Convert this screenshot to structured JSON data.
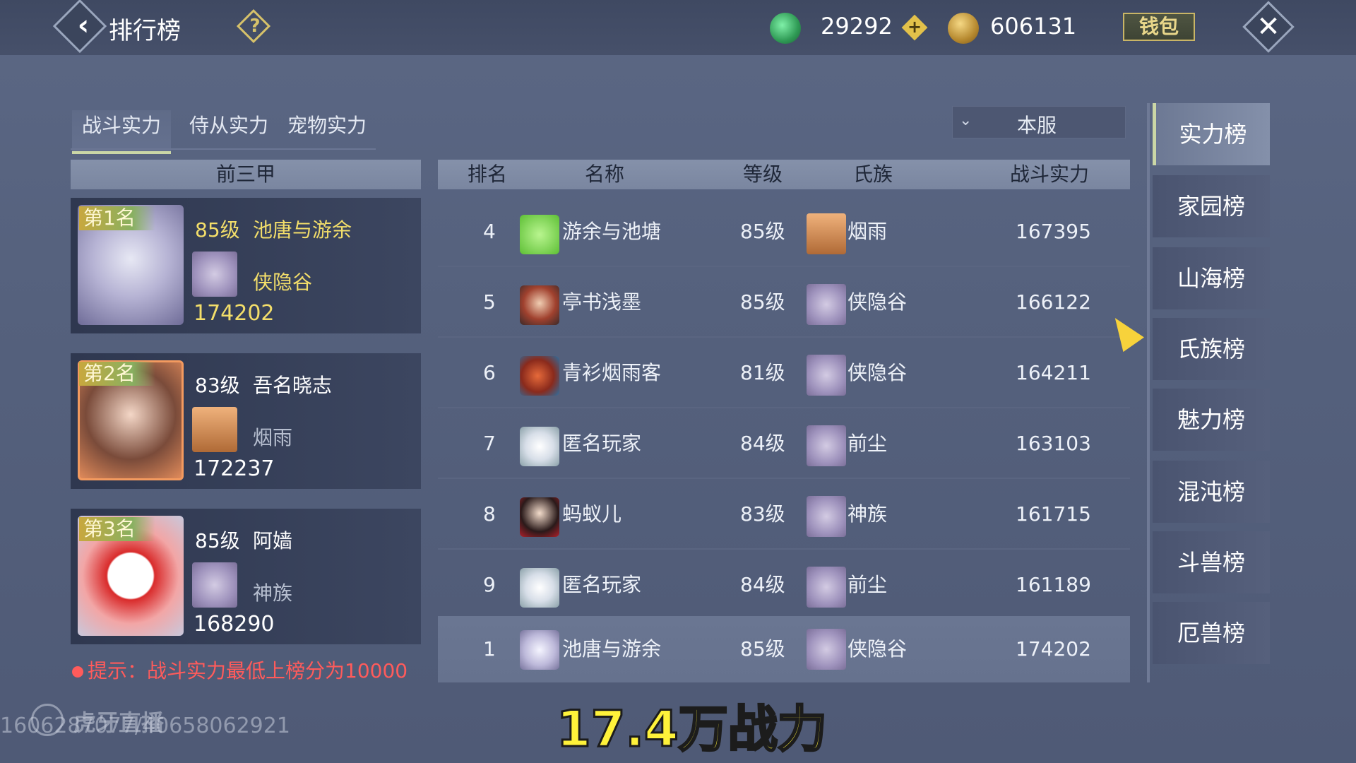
{
  "header": {
    "title": "排行榜",
    "jade_value": "29292",
    "coin_value": "606131",
    "wallet_label": "钱包"
  },
  "tabs": [
    {
      "label": "战斗实力",
      "active": true
    },
    {
      "label": "侍从实力",
      "active": false
    },
    {
      "label": "宠物实力",
      "active": false
    }
  ],
  "server_filter": "本服",
  "top3": {
    "header": "前三甲",
    "cards": [
      {
        "rank_label": "第1名",
        "level": "85级",
        "name": "池唐与游余",
        "clan": "侠隐谷",
        "power": "174202"
      },
      {
        "rank_label": "第2名",
        "level": "83级",
        "name": "吾名晓志",
        "clan": "烟雨",
        "power": "172237"
      },
      {
        "rank_label": "第3名",
        "level": "85级",
        "name": "阿嫱",
        "clan": "神族",
        "power": "168290"
      }
    ]
  },
  "hint": "提示：战斗实力最低上榜分为10000",
  "table": {
    "headers": [
      "排名",
      "名称",
      "等级",
      "氏族",
      "战斗实力"
    ],
    "rows": [
      {
        "rank": "4",
        "name": "游余与池塘",
        "level": "85级",
        "clan": "烟雨",
        "power": "167395"
      },
      {
        "rank": "5",
        "name": "亭书浅墨",
        "level": "85级",
        "clan": "侠隐谷",
        "power": "166122"
      },
      {
        "rank": "6",
        "name": "青衫烟雨客",
        "level": "81级",
        "clan": "侠隐谷",
        "power": "164211"
      },
      {
        "rank": "7",
        "name": "匿名玩家",
        "level": "84级",
        "clan": "前尘",
        "power": "163103"
      },
      {
        "rank": "8",
        "name": "蚂蚁儿",
        "level": "83级",
        "clan": "神族",
        "power": "161715"
      },
      {
        "rank": "9",
        "name": "匿名玩家",
        "level": "84级",
        "clan": "前尘",
        "power": "161189"
      }
    ],
    "my_row": {
      "rank": "1",
      "name": "池唐与游余",
      "level": "85级",
      "clan": "侠隐谷",
      "power": "174202"
    }
  },
  "right_nav": [
    {
      "label": "实力榜",
      "active": true
    },
    {
      "label": "家园榜",
      "active": false
    },
    {
      "label": "山海榜",
      "active": false
    },
    {
      "label": "氏族榜",
      "active": false
    },
    {
      "label": "魅力榜",
      "active": false
    },
    {
      "label": "混沌榜",
      "active": false
    },
    {
      "label": "斗兽榜",
      "active": false
    },
    {
      "label": "厄兽榜",
      "active": false
    }
  ],
  "overlay": {
    "watermark_brand": "虎牙直播",
    "watermark_id": "1606287077/40658062921",
    "caption": "17.4万战力"
  },
  "icons": [
    "back-arrow-icon",
    "help-icon",
    "jade-currency-icon",
    "plus-icon",
    "coin-currency-icon",
    "close-icon",
    "chevron-down-icon",
    "clan-emblem-icon",
    "player-avatar-icon",
    "cursor-icon"
  ]
}
